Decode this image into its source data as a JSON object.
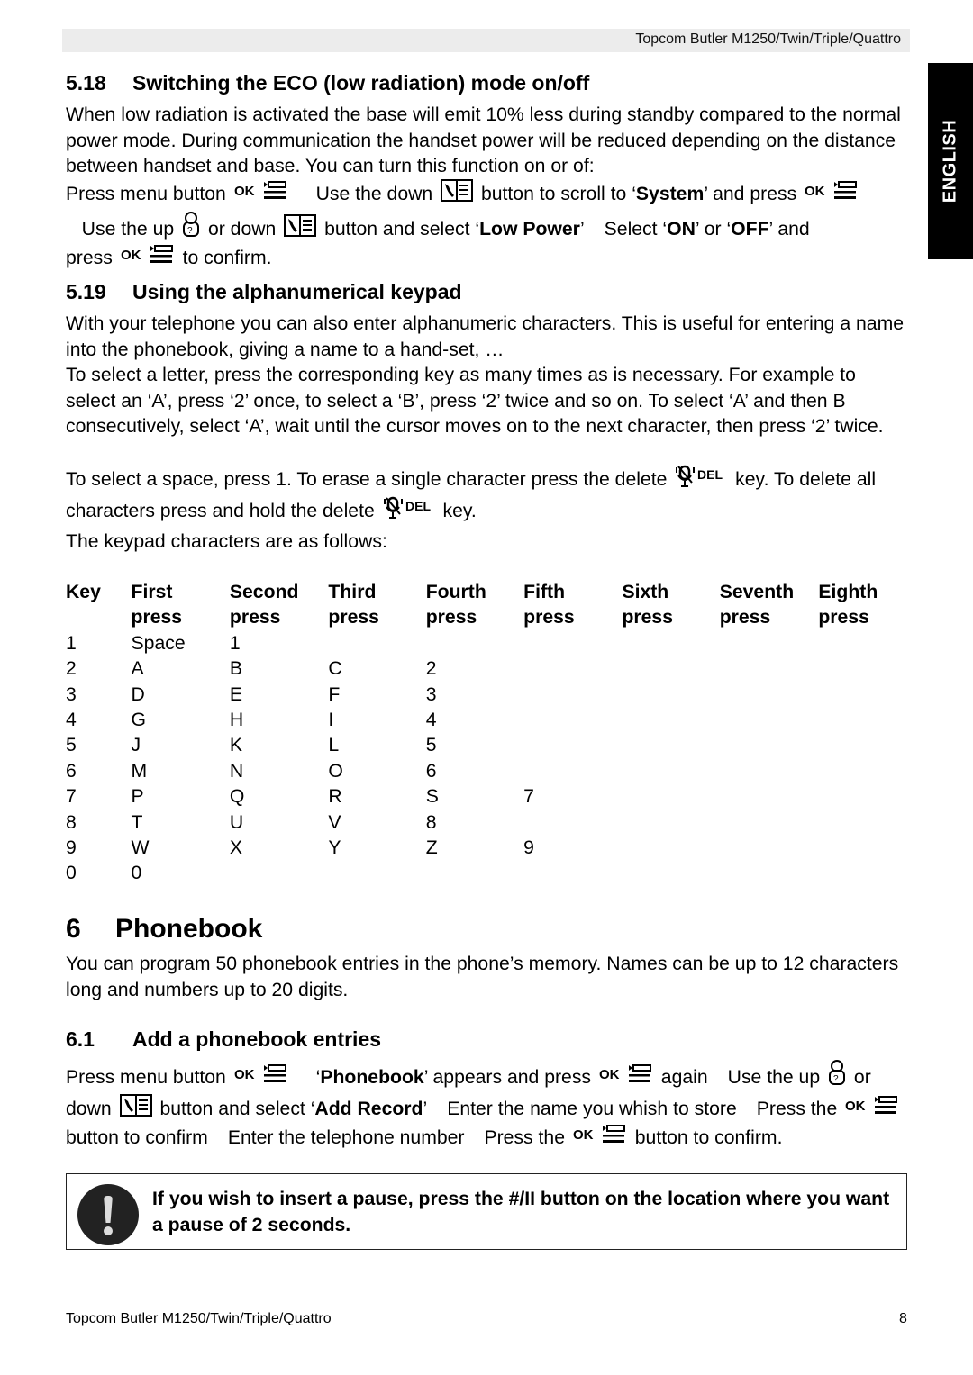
{
  "header": {
    "title": "Topcom Butler M1250/Twin/Triple/Quattro"
  },
  "language_tab": "ENGLISH",
  "icons": {
    "ok": "OK",
    "del": "DEL"
  },
  "s518": {
    "number": "5.18",
    "title": "Switching the ECO (low radiation) mode on/off",
    "intro": "When low radiation is activated the base will emit 10% less during standby compared to the normal power mode. During communication the handset power will be reduced depending on the distance between handset and base. You can turn this function on or of:",
    "steps": {
      "t1": "Press menu button",
      "t2": "Use the down",
      "t3": "button to scroll to ‘",
      "b1": "System",
      "t4": "’ and press",
      "t5": "Use the up",
      "t6": "or down",
      "t7": "button and select ‘",
      "b2": "Low Power",
      "t8": "’",
      "t9": "Select ‘",
      "b3": "ON",
      "t10": "’ or ‘",
      "b4": "OFF",
      "t11": "’ and",
      "t12": "press",
      "t13": "to confirm."
    }
  },
  "s519": {
    "number": "5.19",
    "title": "Using the alphanumerical keypad",
    "p1": "With your telephone you can also enter alphanumeric characters. This is useful for entering a name into the phonebook, giving a name to a hand-set, …",
    "p2": "To select a letter, press the corresponding key as many times as is necessary. For example to select an ‘A’, press ‘2’ once, to select a ‘B’, press ‘2’ twice and so on. To select ‘A’ and then B consecutively, select ‘A’, wait until the cursor moves on to the next character, then press ‘2’ twice.",
    "p3a": "To select a space, press 1. To erase a single character press the delete",
    "p3b": "key. To delete all characters press and hold the delete",
    "p3c": "key.",
    "p4": "The keypad characters are as follows:",
    "table": {
      "headers": [
        [
          "Key",
          ""
        ],
        [
          "First",
          "press"
        ],
        [
          "Second",
          "press"
        ],
        [
          "Third",
          "press"
        ],
        [
          "Fourth",
          "press"
        ],
        [
          "Fifth",
          "press"
        ],
        [
          "Sixth",
          "press"
        ],
        [
          "Seventh",
          "press"
        ],
        [
          "Eighth",
          "press"
        ]
      ],
      "rows": [
        [
          "1",
          "Space",
          "1",
          "",
          "",
          "",
          "",
          "",
          ""
        ],
        [
          "2",
          "A",
          "B",
          "C",
          "2",
          "",
          "",
          "",
          ""
        ],
        [
          "3",
          "D",
          "E",
          "F",
          "3",
          "",
          "",
          "",
          ""
        ],
        [
          "4",
          "G",
          "H",
          "I",
          "4",
          "",
          "",
          "",
          ""
        ],
        [
          "5",
          "J",
          "K",
          "L",
          "5",
          "",
          "",
          "",
          ""
        ],
        [
          "6",
          "M",
          "N",
          "O",
          "6",
          "",
          "",
          "",
          ""
        ],
        [
          "7",
          "P",
          "Q",
          "R",
          "S",
          "7",
          "",
          "",
          ""
        ],
        [
          "8",
          "T",
          "U",
          "V",
          "8",
          "",
          "",
          "",
          ""
        ],
        [
          "9",
          "W",
          "X",
          "Y",
          "Z",
          "9",
          "",
          "",
          ""
        ],
        [
          "0",
          "0",
          "",
          "",
          "",
          "",
          "",
          "",
          ""
        ]
      ]
    }
  },
  "s6": {
    "number": "6",
    "title": "Phonebook",
    "intro": "You can program 50 phonebook entries in the phone’s memory. Names can be up to 12 characters long and numbers up to 20 digits."
  },
  "s61": {
    "number": "6.1",
    "title": "Add a phonebook entries",
    "steps": {
      "t1": "Press menu button",
      "t2": "‘",
      "b1": "Phonebook",
      "t3": "’ appears and press",
      "t4": "again",
      "t5": "Use the up",
      "t6": "or down",
      "t7": "button and select ‘",
      "b2": "Add Record",
      "t8": "’",
      "t9": "Enter the name you whish to store",
      "t10": "Press the",
      "t11": "button to confirm",
      "t12": "Enter the telephone number",
      "t13": "Press the",
      "t14": "button to confirm."
    }
  },
  "notice": {
    "text": "If you wish to insert a pause, press the #/II button on the location where you want a pause of 2 seconds."
  },
  "footer": {
    "title": "Topcom Butler M1250/Twin/Triple/Quattro",
    "page_number": "8"
  }
}
